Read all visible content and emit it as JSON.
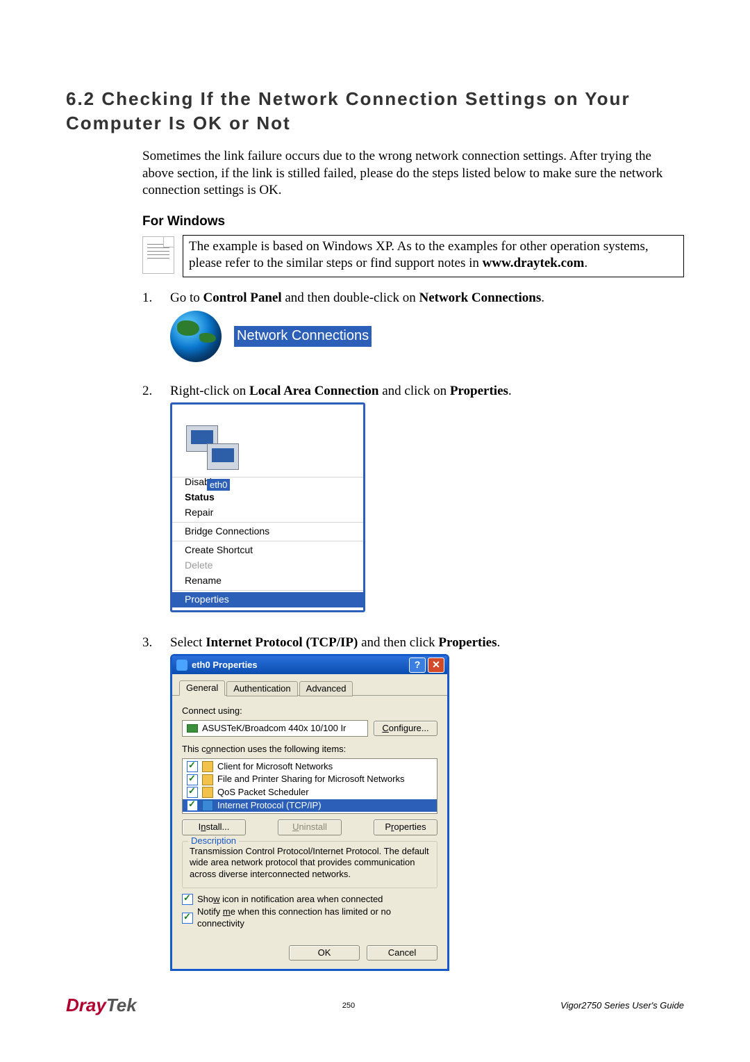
{
  "heading": "6.2 Checking If the Network Connection Settings on Your Computer Is OK or Not",
  "intro": "Sometimes the link failure occurs due to the wrong network connection settings. After trying the above section, if the link is stilled failed, please do the steps listed below to make sure the network connection settings is OK.",
  "subheading": "For Windows",
  "note": {
    "text_pre": "The example is based on Windows XP. As to the examples for other operation systems, please refer to the similar steps or find support notes in ",
    "bold": "www.draytek.com",
    "after": "."
  },
  "steps": {
    "s1": {
      "num": "1.",
      "pre": "Go to ",
      "b1": "Control Panel",
      "mid": " and then double-click on ",
      "b2": "Network Connections",
      "after": "."
    },
    "s2": {
      "num": "2.",
      "pre": "Right-click on ",
      "b1": "Local Area Connection",
      "mid": " and click on ",
      "b2": "Properties",
      "after": "."
    },
    "s3": {
      "num": "3.",
      "pre": "Select ",
      "b1": "Internet Protocol (TCP/IP)",
      "mid": " and then click ",
      "b2": "Properties",
      "after": "."
    }
  },
  "fig1": {
    "label": "Network Connections"
  },
  "fig2": {
    "eth0": "eth0",
    "menu": {
      "disable": "Disable",
      "status": "Status",
      "repair": "Repair",
      "bridge": "Bridge Connections",
      "shortcut": "Create Shortcut",
      "delete": "Delete",
      "rename": "Rename",
      "properties": "Properties"
    }
  },
  "fig3": {
    "title": "eth0 Properties",
    "help": "?",
    "close": "✕",
    "tabs": {
      "general": "General",
      "auth": "Authentication",
      "adv": "Advanced"
    },
    "connect_using": "Connect using:",
    "adapter": "ASUSTeK/Broadcom 440x 10/100 Ir",
    "configure": "Configure...",
    "uses_label": "This connection uses the following items:",
    "items": {
      "client": "Client for Microsoft Networks",
      "fps": "File and Printer Sharing for Microsoft Networks",
      "qos": "QoS Packet Scheduler",
      "tcpip": "Internet Protocol (TCP/IP)"
    },
    "buttons": {
      "install": "Install...",
      "uninstall": "Uninstall",
      "properties": "Properties"
    },
    "desc_legend": "Description",
    "desc_text": "Transmission Control Protocol/Internet Protocol. The default wide area network protocol that provides communication across diverse interconnected networks.",
    "show_icon": "Show icon in notification area when connected",
    "notify": "Notify me when this connection has limited or no connectivity",
    "ok": "OK",
    "cancel": "Cancel"
  },
  "footer": {
    "logo1": "Dray",
    "logo2": "Tek",
    "page": "250",
    "guide": "Vigor2750  Series  User's  Guide"
  }
}
